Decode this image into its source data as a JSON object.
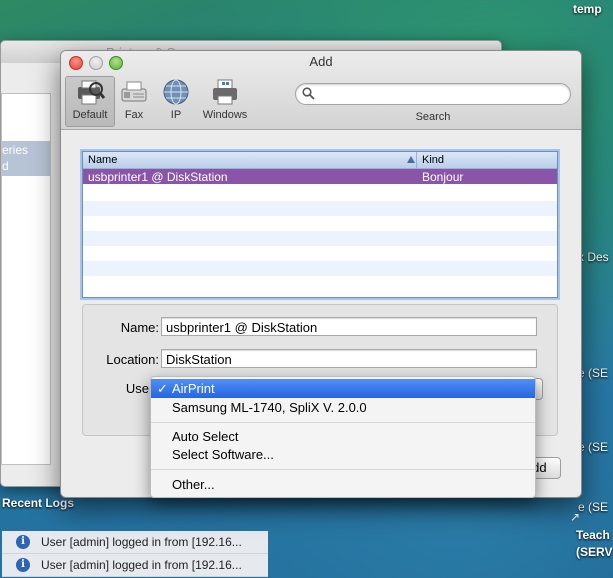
{
  "desktop": {
    "top_right_label": "temp",
    "right_edge_labels": [
      "x Des",
      "e (SE",
      "e (SE",
      "e (SE"
    ],
    "bottom_right_icon_label_1": "Teach",
    "bottom_right_icon_label_2": "(SERV"
  },
  "background_window": {
    "title": "Printers & Scanners",
    "sidebar_selected_line_1": "eries",
    "sidebar_selected_line_2": "d"
  },
  "recent_logs": {
    "title": "Recent Logs",
    "rows": [
      "User [admin] logged in from [192.16...",
      "User [admin] logged in from [192.16..."
    ]
  },
  "add_window": {
    "title": "Add",
    "toolbar": {
      "default_label": "Default",
      "fax_label": "Fax",
      "ip_label": "IP",
      "windows_label": "Windows",
      "search_label": "Search",
      "search_value": ""
    },
    "printer_list": {
      "col_name": "Name",
      "col_kind": "Kind",
      "rows": [
        {
          "name": "usbprinter1 @ DiskStation",
          "kind": "Bonjour"
        }
      ]
    },
    "details": {
      "name_label": "Name:",
      "name_value": "usbprinter1 @ DiskStation",
      "location_label": "Location:",
      "location_value": "DiskStation",
      "use_label": "Use"
    },
    "add_button": "Add",
    "use_menu": {
      "checkmark": "✓",
      "items": [
        "AirPrint",
        "Samsung ML-1740, SpliX V. 2.0.0",
        "Auto Select",
        "Select Software...",
        "Other..."
      ],
      "selected_index": 0
    }
  },
  "colors": {
    "selection_purple": "#8a55a8",
    "menu_highlight": "#2766e0",
    "list_focus": "#a7c5ea"
  }
}
